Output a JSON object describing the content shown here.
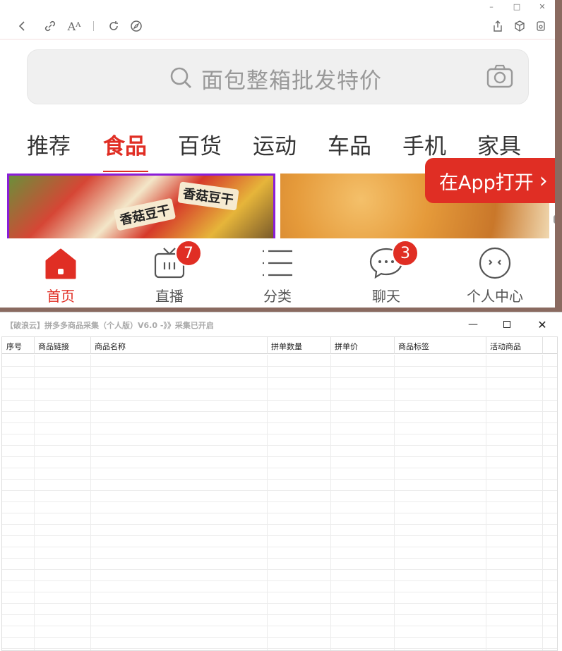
{
  "browser": {
    "window_controls": {
      "minimize": "–",
      "maximize": "□",
      "close": "✕"
    },
    "search": {
      "placeholder": "面包整箱批发特价"
    },
    "categories": [
      "推荐",
      "食品",
      "百货",
      "运动",
      "车品",
      "手机",
      "家具"
    ],
    "active_category": "食品",
    "banner_left": {
      "pack1": "香菇豆干",
      "pack2": "香菇豆干"
    },
    "open_app": {
      "label": "在App打开"
    },
    "bottom_nav": [
      {
        "label": "首页",
        "icon": "home-icon",
        "active": true
      },
      {
        "label": "直播",
        "icon": "live-tv-icon",
        "badge": "7"
      },
      {
        "label": "分类",
        "icon": "category-list-icon"
      },
      {
        "label": "聊天",
        "icon": "chat-icon",
        "badge": "3"
      },
      {
        "label": "个人中心",
        "icon": "profile-icon"
      }
    ],
    "accent_color": "#e02e24"
  },
  "app": {
    "title": "【破浪云】拼多多商品采集（个人版）V6.0 -》》采集已开启",
    "columns": [
      "序号",
      "商品链接",
      "商品名称",
      "拼单数量",
      "拼单价",
      "商品标签",
      "活动商品"
    ],
    "rows": []
  }
}
